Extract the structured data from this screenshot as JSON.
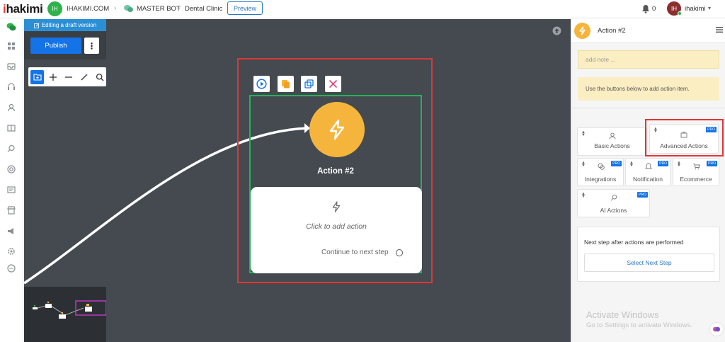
{
  "topbar": {
    "logo_prefix": "i",
    "logo_rest": "hakimi",
    "workspace_initials": "IH",
    "workspace_name": "IHAKIMI.COM",
    "bot_name": "MASTER BOT",
    "page_name": "Dental Clinic",
    "preview_label": "Preview",
    "notifications_count": "0",
    "user_initials": "IH",
    "user_name": "ihakimi"
  },
  "canvas": {
    "draft_label": "Editing a draft version",
    "publish_label": "Publish",
    "node": {
      "title": "Action #2",
      "add_action": "Click to add action",
      "continue_label": "Continue to next step"
    }
  },
  "panel": {
    "title": "Action #2",
    "note_placeholder": "add note ...",
    "hint": "Use the buttons below to add action item.",
    "actions": [
      {
        "label": "Basic Actions",
        "pro": ""
      },
      {
        "label": "Advanced Actions",
        "pro": "PRO"
      },
      {
        "label": "Integrations",
        "pro": "PRO"
      },
      {
        "label": "Notification",
        "pro": "PRO"
      },
      {
        "label": "Ecommerce",
        "pro": "PRO"
      },
      {
        "label": "AI Actions",
        "pro": "PRO"
      }
    ],
    "next_step_title": "Next step after actions are performed",
    "select_next_label": "Select Next Step"
  },
  "watermark": {
    "line1": "Activate Windows",
    "line2": "Go to Settings to activate Windows."
  },
  "colors": {
    "accent": "#1473e6",
    "canvas_bg": "#444a50",
    "node_circle": "#f5b53d",
    "selection_red": "#e03636",
    "node_green": "#23b35a",
    "note_bg": "#fbeec2"
  }
}
